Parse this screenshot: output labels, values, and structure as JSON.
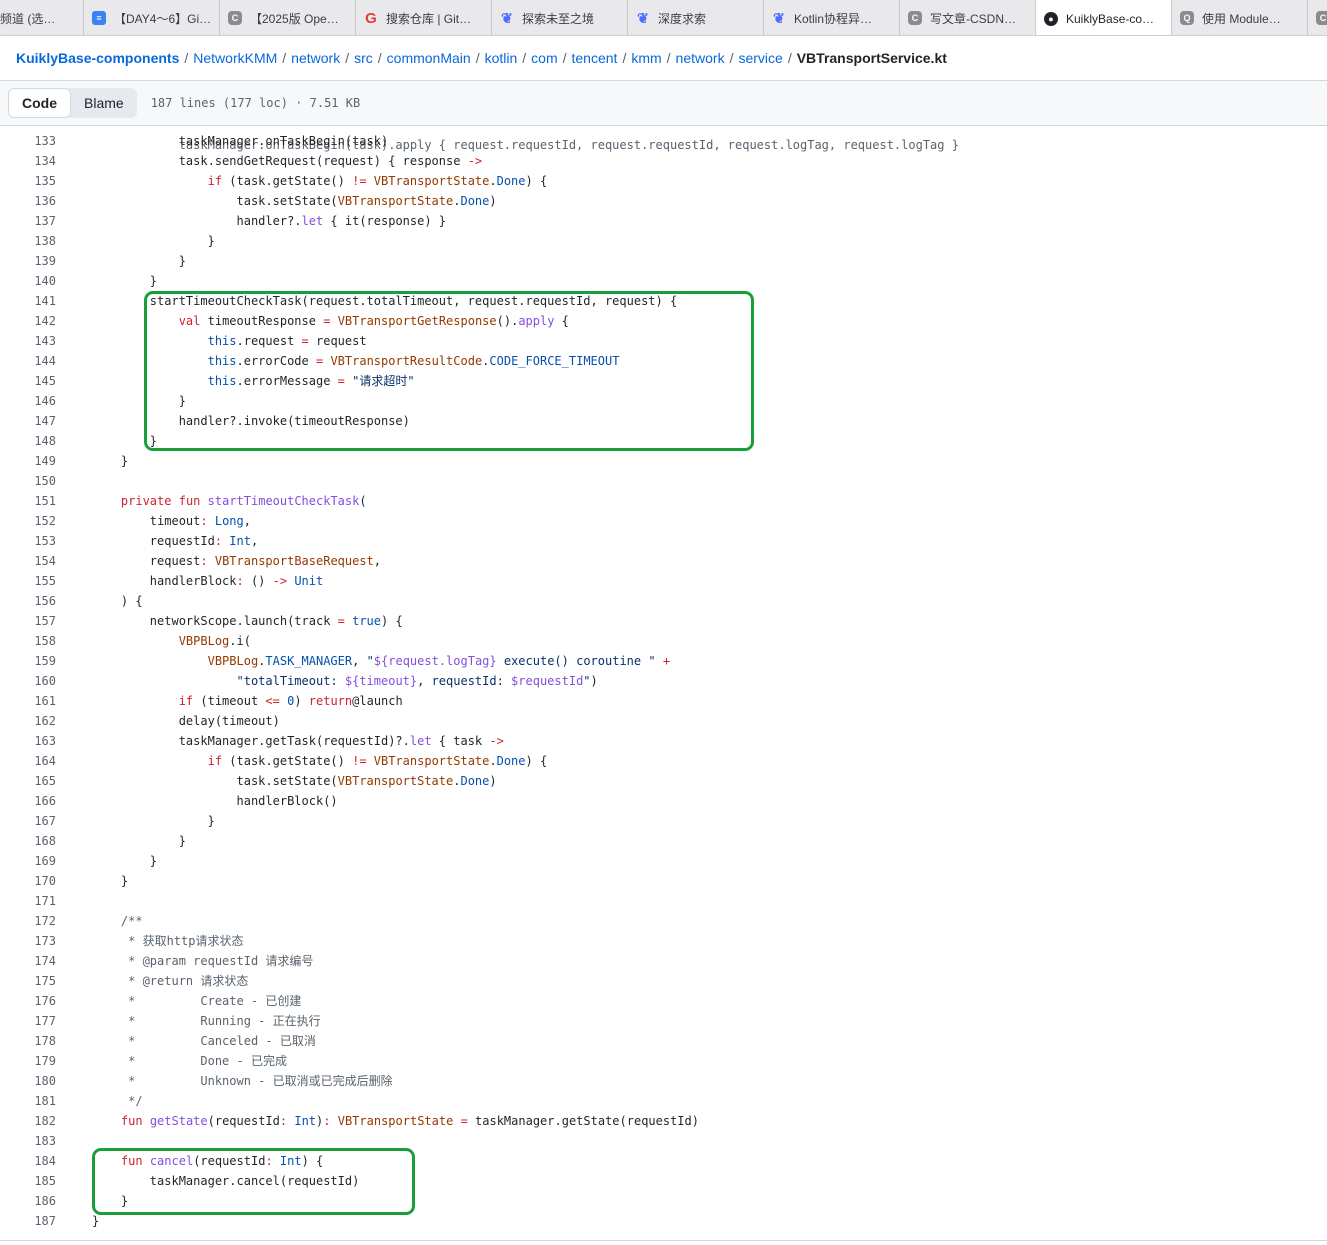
{
  "tabs": [
    {
      "label": "频道 (选…",
      "icon": "none",
      "active": false,
      "width": 84
    },
    {
      "label": "【DAY4～6】Gi…",
      "icon": "doc",
      "active": false,
      "width": 136
    },
    {
      "label": "【2025版 Ope…",
      "icon": "csdn",
      "active": false,
      "width": 136
    },
    {
      "label": "搜索仓库 | Git…",
      "icon": "g",
      "active": false,
      "width": 136
    },
    {
      "label": "探索未至之境",
      "icon": "whale",
      "active": false,
      "width": 136
    },
    {
      "label": "深度求索",
      "icon": "whale",
      "active": false,
      "width": 136
    },
    {
      "label": "Kotlin协程异…",
      "icon": "whale",
      "active": false,
      "width": 136
    },
    {
      "label": "写文章-CSDN…",
      "icon": "csdn",
      "active": false,
      "width": 136
    },
    {
      "label": "KuiklyBase-co…",
      "icon": "gh",
      "active": true,
      "width": 136
    },
    {
      "label": "使用 Module…",
      "icon": "q",
      "active": false,
      "width": 136
    },
    {
      "label": "",
      "icon": "csdn",
      "active": false,
      "width": 40
    }
  ],
  "breadcrumb": {
    "repo": "KuiklyBase-components",
    "parts": [
      "NetworkKMM",
      "network",
      "src",
      "commonMain",
      "kotlin",
      "com",
      "tencent",
      "kmm",
      "network",
      "service"
    ],
    "file": "VBTransportService.kt"
  },
  "toolbar": {
    "code_label": "Code",
    "blame_label": "Blame",
    "file_meta": "187 lines (177 loc) · 7.51 KB"
  },
  "code_lines": [
    {
      "n": "133",
      "html": "            taskManager.onTaskBegin(task)"
    },
    {
      "n": "134",
      "html": "            task.sendGetRequest(request) { response <span class=\"k\">-&gt;</span>"
    },
    {
      "n": "135",
      "html": "                <span class=\"k\">if</span> (task.getState() <span class=\"k\">!=</span> <span class=\"t\">VBTransportState</span>.<span class=\"c\">Done</span>) {"
    },
    {
      "n": "136",
      "html": "                    task.setState(<span class=\"t\">VBTransportState</span>.<span class=\"c\">Done</span>)"
    },
    {
      "n": "137",
      "html": "                    handler?.<span class=\"f\">let</span> { it(response) }"
    },
    {
      "n": "138",
      "html": "                }"
    },
    {
      "n": "139",
      "html": "            }"
    },
    {
      "n": "140",
      "html": "        }"
    },
    {
      "n": "141",
      "html": "        startTimeoutCheckTask(request.totalTimeout, request.requestId, request) {"
    },
    {
      "n": "142",
      "html": "            <span class=\"k\">val</span> timeoutResponse <span class=\"k\">=</span> <span class=\"t\">VBTransportGetResponse</span>().<span class=\"f\">apply</span> {"
    },
    {
      "n": "143",
      "html": "                <span class=\"c\">this</span>.request <span class=\"k\">=</span> request"
    },
    {
      "n": "144",
      "html": "                <span class=\"c\">this</span>.errorCode <span class=\"k\">=</span> <span class=\"t\">VBTransportResultCode</span>.<span class=\"c\">CODE_FORCE_TIMEOUT</span>"
    },
    {
      "n": "145",
      "html": "                <span class=\"c\">this</span>.errorMessage <span class=\"k\">=</span> <span class=\"s\">\"请求超时\"</span>"
    },
    {
      "n": "146",
      "html": "            }"
    },
    {
      "n": "147",
      "html": "            handler?.invoke(timeoutResponse)"
    },
    {
      "n": "148",
      "html": "        }"
    },
    {
      "n": "149",
      "html": "    }"
    },
    {
      "n": "150",
      "html": ""
    },
    {
      "n": "151",
      "html": "    <span class=\"k\">private</span> <span class=\"k\">fun</span> <span class=\"f\">startTimeoutCheckTask</span>("
    },
    {
      "n": "152",
      "html": "        timeout<span class=\"k\">:</span> <span class=\"c\">Long</span>,"
    },
    {
      "n": "153",
      "html": "        requestId<span class=\"k\">:</span> <span class=\"c\">Int</span>,"
    },
    {
      "n": "154",
      "html": "        request<span class=\"k\">:</span> <span class=\"t\">VBTransportBaseRequest</span>,"
    },
    {
      "n": "155",
      "html": "        handlerBlock<span class=\"k\">:</span> () <span class=\"k\">-&gt;</span> <span class=\"c\">Unit</span>"
    },
    {
      "n": "156",
      "html": "    ) {"
    },
    {
      "n": "157",
      "html": "        networkScope.launch(track <span class=\"k\">=</span> <span class=\"c\">true</span>) {"
    },
    {
      "n": "158",
      "html": "            <span class=\"t\">VBPBLog</span>.i("
    },
    {
      "n": "159",
      "html": "                <span class=\"t\">VBPBLog</span>.<span class=\"c\">TASK_MANAGER</span>, <span class=\"s\">\"</span><span class=\"f\">${request.logTag}</span><span class=\"s\"> execute() coroutine \"</span> <span class=\"k\">+</span>"
    },
    {
      "n": "160",
      "html": "                    <span class=\"s\">\"totalTimeout: </span><span class=\"f\">${timeout}</span><span class=\"s\">, requestId: </span><span class=\"f\">$requestId</span><span class=\"s\">\"</span>)"
    },
    {
      "n": "161",
      "html": "            <span class=\"k\">if</span> (timeout <span class=\"k\">&lt;=</span> <span class=\"c\">0</span>) <span class=\"k\">return</span>@launch"
    },
    {
      "n": "162",
      "html": "            delay(timeout)"
    },
    {
      "n": "163",
      "html": "            taskManager.getTask(requestId)?.<span class=\"f\">let</span> { task <span class=\"k\">-&gt;</span>"
    },
    {
      "n": "164",
      "html": "                <span class=\"k\">if</span> (task.getState() <span class=\"k\">!=</span> <span class=\"t\">VBTransportState</span>.<span class=\"c\">Done</span>) {"
    },
    {
      "n": "165",
      "html": "                    task.setState(<span class=\"t\">VBTransportState</span>.<span class=\"c\">Done</span>)"
    },
    {
      "n": "166",
      "html": "                    handlerBlock()"
    },
    {
      "n": "167",
      "html": "                }"
    },
    {
      "n": "168",
      "html": "            }"
    },
    {
      "n": "169",
      "html": "        }"
    },
    {
      "n": "170",
      "html": "    }"
    },
    {
      "n": "171",
      "html": ""
    },
    {
      "n": "172",
      "html": "    <span class=\"cm\">/**</span>"
    },
    {
      "n": "173",
      "html": "    <span class=\"cm\"> * 获取http请求状态</span>"
    },
    {
      "n": "174",
      "html": "    <span class=\"cm\"> * @param requestId 请求编号</span>"
    },
    {
      "n": "175",
      "html": "    <span class=\"cm\"> * @return 请求状态</span>"
    },
    {
      "n": "176",
      "html": "    <span class=\"cm\"> *         Create - 已创建</span>"
    },
    {
      "n": "177",
      "html": "    <span class=\"cm\"> *         Running - 正在执行</span>"
    },
    {
      "n": "178",
      "html": "    <span class=\"cm\"> *         Canceled - 已取消</span>"
    },
    {
      "n": "179",
      "html": "    <span class=\"cm\"> *         Done - 已完成</span>"
    },
    {
      "n": "180",
      "html": "    <span class=\"cm\"> *         Unknown - 已取消或已完成后删除</span>"
    },
    {
      "n": "181",
      "html": "    <span class=\"cm\"> */</span>"
    },
    {
      "n": "182",
      "html": "    <span class=\"k\">fun</span> <span class=\"f\">getState</span>(requestId<span class=\"k\">:</span> <span class=\"c\">Int</span>)<span class=\"k\">:</span> <span class=\"t\">VBTransportState</span> <span class=\"k\">=</span> taskManager.getState(requestId)"
    },
    {
      "n": "183",
      "html": ""
    },
    {
      "n": "184",
      "html": "    <span class=\"k\">fun</span> <span class=\"f\">cancel</span>(requestId<span class=\"k\">:</span> <span class=\"c\">Int</span>) {"
    },
    {
      "n": "185",
      "html": "        taskManager.cancel(requestId)"
    },
    {
      "n": "186",
      "html": "    }"
    },
    {
      "n": "187",
      "html": "}"
    }
  ],
  "colors": {
    "highlight_frame": "#1a9e3a",
    "keyword": "#cf222e",
    "function": "#8250df",
    "type": "#953800",
    "constant": "#0550ae",
    "string": "#0a3069",
    "comment": "#59636e",
    "link": "#0969da"
  }
}
